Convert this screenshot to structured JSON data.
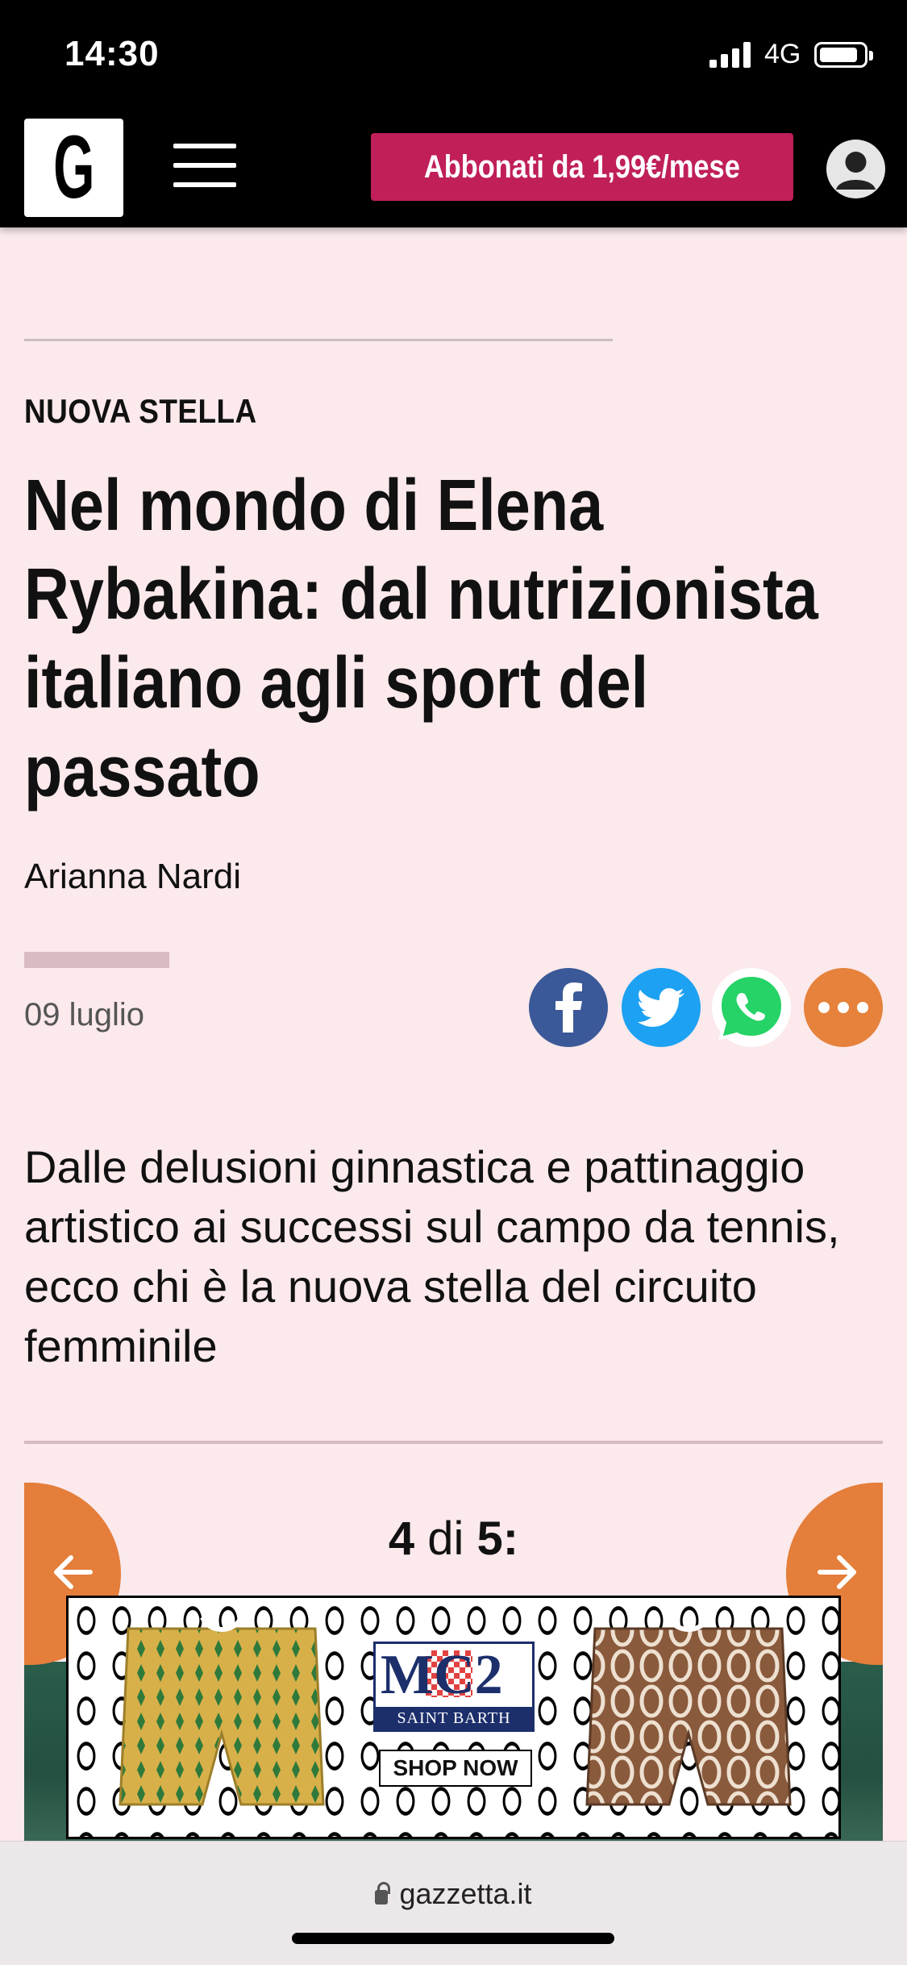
{
  "status_bar": {
    "time": "14:30",
    "network": "4G"
  },
  "header": {
    "logo_letter": "G",
    "subscribe_label": "Abbonati da 1,99€/mese"
  },
  "article": {
    "kicker": "NUOVA STELLA",
    "headline_lines": [
      "Nel mondo di Elena",
      "Rybakina: dal nutrizionista",
      "italiano agli sport del",
      "passato"
    ],
    "author": "Arianna Nardi",
    "date": "09 luglio",
    "summary": "Dalle delusioni ginnastica e pattinaggio artistico ai successi sul campo da tennis, ecco chi è la nuova stella del circuito femminile"
  },
  "share": {
    "icons": [
      "facebook-icon",
      "twitter-icon",
      "whatsapp-icon",
      "more-icon"
    ]
  },
  "gallery": {
    "current": "4",
    "separator": "di",
    "total": "5:"
  },
  "ad": {
    "brand_mark": "MC2",
    "brand_sub": "SAINT BARTH",
    "cta": "SHOP NOW"
  },
  "browser": {
    "url": "gazzetta.it"
  },
  "colors": {
    "page_bg": "#fbe9ec",
    "subscribe_bg": "#c01f5a",
    "gallery_arrow": "#e47e3a",
    "facebook": "#3b5998",
    "twitter": "#1da1f2",
    "whatsapp": "#25d366",
    "more": "#e6823b"
  }
}
